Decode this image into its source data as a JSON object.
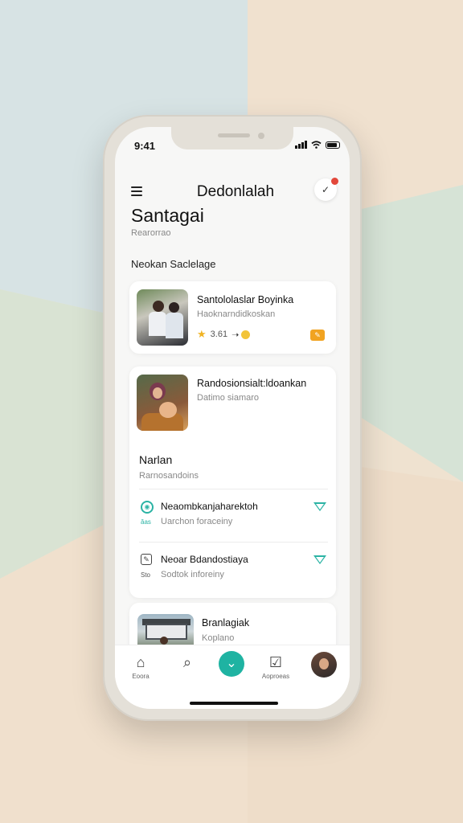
{
  "status_bar": {
    "time": "9:41"
  },
  "header": {
    "app_title": "Dedonlalah",
    "page_title": "Santagai",
    "page_subtitle": "Rearorrao",
    "notification_badge_color": "#e2473a"
  },
  "section": {
    "title": "Neokan Saclelage"
  },
  "card1": {
    "title": "Santololaslar Boyinka",
    "subtitle": "Haoknarndidkoskan",
    "rating": "3.61",
    "icons": [
      "star-icon",
      "coin-icon",
      "tag-icon"
    ]
  },
  "card2": {
    "title": "Randosionsialt:ldoankan",
    "subtitle": "Datimo siamaro",
    "section_title": "Narlan",
    "section_subtitle": "Rarnosandoins",
    "rows": [
      {
        "title": "Neaombkanjaharektoh",
        "subtitle": "Uarchon foraceiny",
        "caption": "ăas",
        "icon": "circle-check-icon"
      },
      {
        "title": "Neoar Bdandostiaya",
        "subtitle": "Sodtok inforeiny",
        "caption": "Sto",
        "icon": "edit-icon"
      }
    ]
  },
  "card3": {
    "title": "Branlagiak",
    "subtitle": "Koplano"
  },
  "tabbar": {
    "home_label": "Eoora",
    "approve_label": "Aoproeas",
    "accent_color": "#1fb3a2"
  }
}
